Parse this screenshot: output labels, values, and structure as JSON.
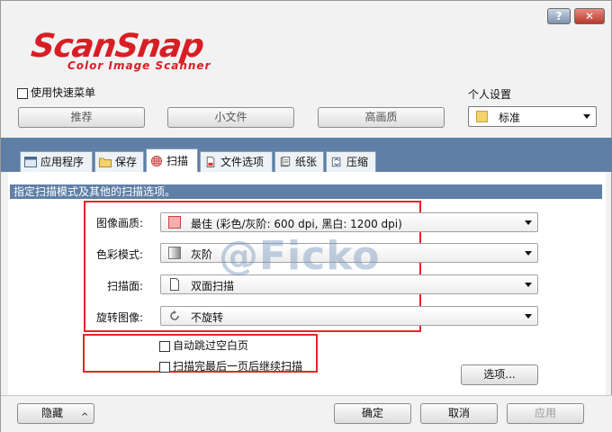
{
  "titlebar": {
    "help": "?",
    "close": "✕"
  },
  "logo": {
    "main": "ScanSnap",
    "sub": "Color Image Scanner"
  },
  "quick_menu": {
    "label": "使用快速菜单",
    "checked": false
  },
  "profile_buttons": [
    "推荐",
    "小文件",
    "高画质"
  ],
  "personal": {
    "label": "个人设置",
    "value": "标准"
  },
  "tabs": [
    {
      "label": "应用程序",
      "icon": "application-icon"
    },
    {
      "label": "保存",
      "icon": "save-folder-icon"
    },
    {
      "label": "扫描",
      "icon": "scan-icon"
    },
    {
      "label": "文件选项",
      "icon": "file-option-icon"
    },
    {
      "label": "纸张",
      "icon": "paper-icon"
    },
    {
      "label": "压缩",
      "icon": "compression-icon"
    }
  ],
  "active_tab": "扫描",
  "description": "指定扫描模式及其他的扫描选项。",
  "settings": {
    "image_quality": {
      "label": "图像画质:",
      "value": "最佳 (彩色/灰阶: 600 dpi, 黑白: 1200 dpi)"
    },
    "color_mode": {
      "label": "色彩模式:",
      "value": "灰阶"
    },
    "scan_side": {
      "label": "扫描面:",
      "value": "双面扫描"
    },
    "rotation": {
      "label": "旋转图像:",
      "value": "不旋转"
    }
  },
  "options": [
    {
      "label": "自动跳过空白页",
      "checked": false
    },
    {
      "label": "扫描完最后一页后继续扫描",
      "checked": false
    }
  ],
  "options_button": "选项...",
  "watermark": "@Ficko",
  "bottom": {
    "hide": "隐藏",
    "ok": "确定",
    "cancel": "取消",
    "apply": "应用"
  },
  "colors": {
    "accent_band": "#5f7fa6",
    "logo_red": "#d81e24",
    "highlight_red": "#e3262c"
  }
}
